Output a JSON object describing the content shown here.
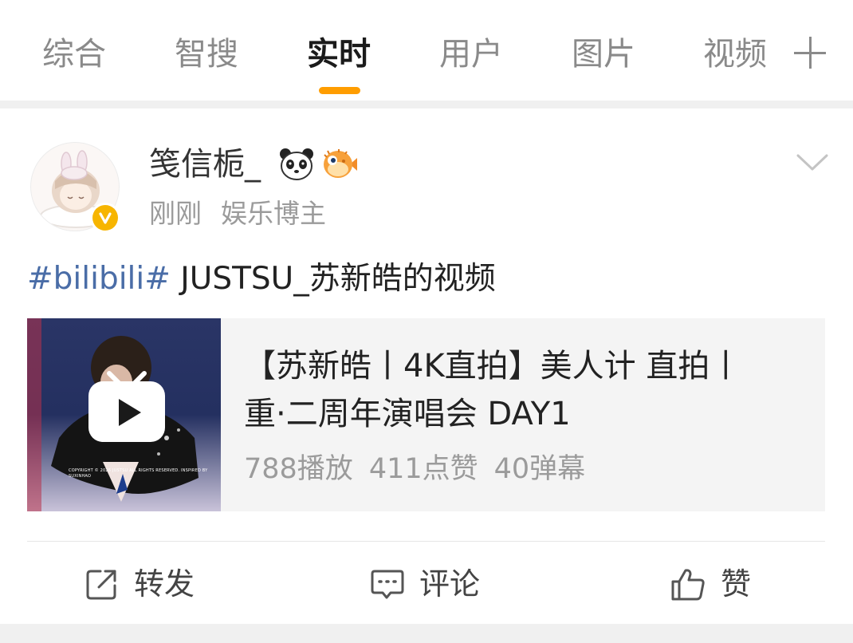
{
  "tabs": [
    {
      "label": "综合"
    },
    {
      "label": "智搜"
    },
    {
      "label": "实时",
      "active": true
    },
    {
      "label": "用户"
    },
    {
      "label": "图片"
    },
    {
      "label": "视频"
    }
  ],
  "tab_more_icon": "plus-icon",
  "accent_color": "#ff9d00",
  "post": {
    "author": "笺信栀_",
    "author_emojis": [
      "panda-emoji",
      "pufferfish-emoji"
    ],
    "verified": true,
    "time": "刚刚",
    "tag": "娱乐博主",
    "hashtag": "#bilibili#",
    "text": " JUSTSU_苏新皓的视频",
    "hashtag_color": "#4a6da7"
  },
  "video_card": {
    "title_line1": "【苏新皓丨4K直拍】美人计 直拍丨",
    "title_line2": "重·二周年演唱会 DAY1",
    "plays": "788播放",
    "likes": "411点赞",
    "danmaku": "40弹幕",
    "thumb_watermark": "COPYRIGHT © 2026 JUSTSU ALL RIGHTS RESERVED. INSPIRED BY SUXINHAO"
  },
  "actions": {
    "repost": "转发",
    "comment": "评论",
    "like": "赞"
  }
}
